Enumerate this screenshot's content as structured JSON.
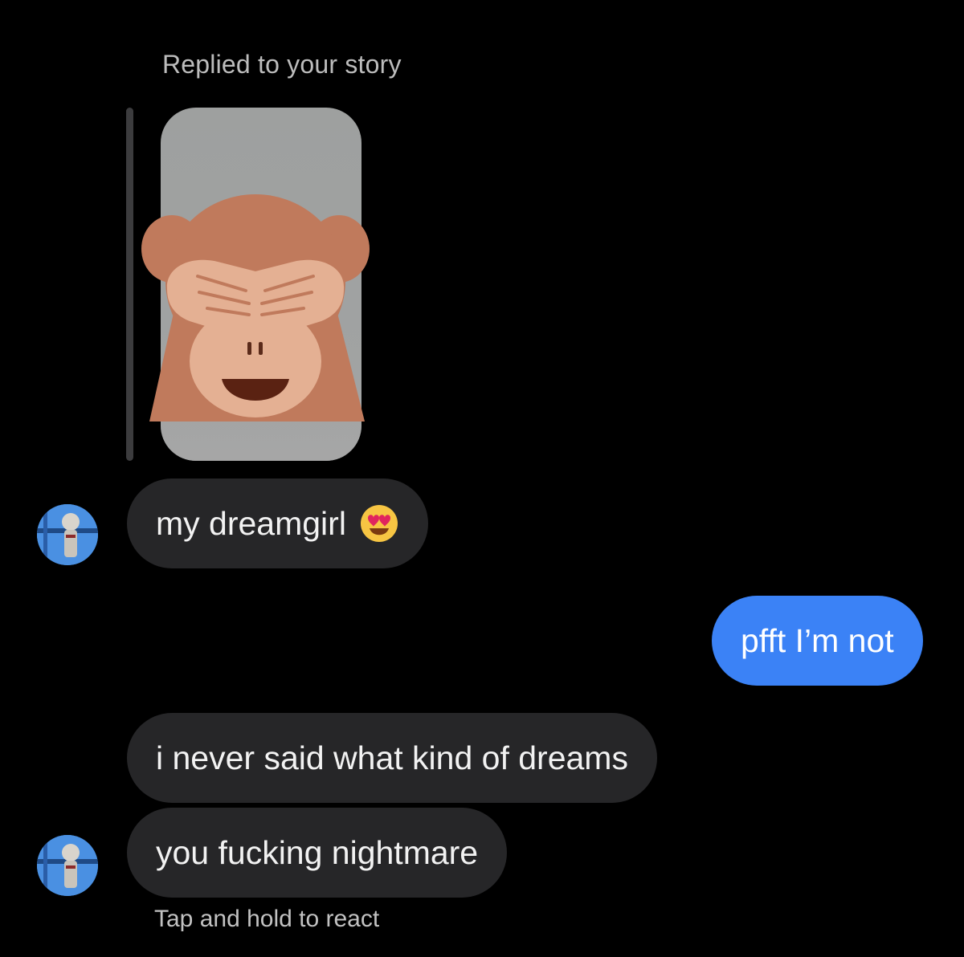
{
  "story_reply": {
    "label": "Replied to your story",
    "thumbnail_icon": "see-no-evil-monkey-emoji"
  },
  "messages": [
    {
      "from": "them",
      "text": "my dreamgirl",
      "emoji": "heart-eyes-emoji"
    },
    {
      "from": "me",
      "text": "pfft I’m not"
    },
    {
      "from": "them",
      "text": "i never said what kind of dreams"
    },
    {
      "from": "them",
      "text": "you fucking nightmare"
    }
  ],
  "react_hint": "Tap and hold to react",
  "colors": {
    "background": "#000000",
    "incoming_bubble": "#262628",
    "outgoing_bubble": "#3b82f6",
    "muted_text": "#bdbdbd"
  }
}
